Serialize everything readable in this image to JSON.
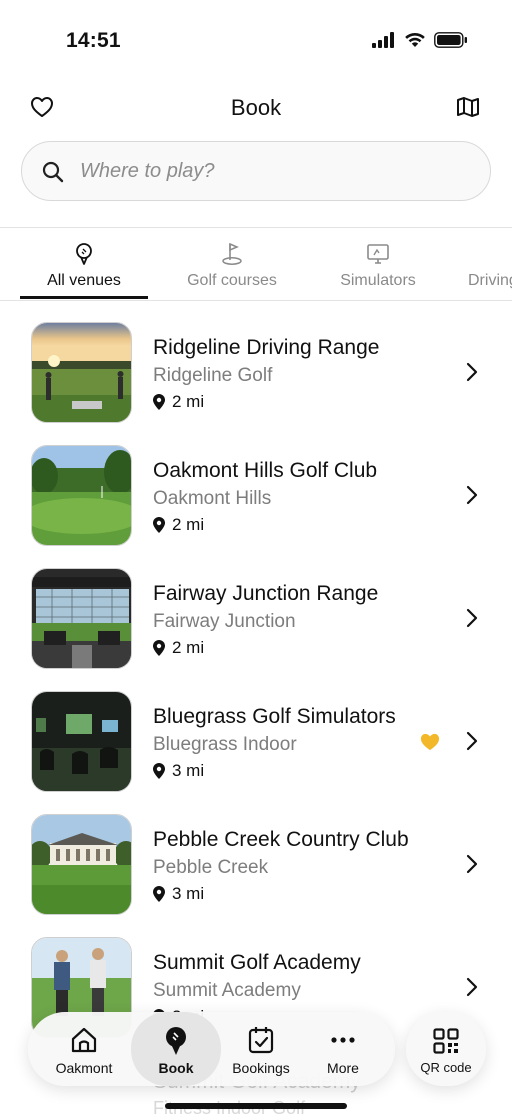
{
  "status": {
    "time": "14:51"
  },
  "header": {
    "title": "Book"
  },
  "search": {
    "placeholder": "Where to play?",
    "value": ""
  },
  "tabs": [
    {
      "label": "All venues",
      "icon": "golf-ball-tee-icon",
      "active": true
    },
    {
      "label": "Golf courses",
      "icon": "golf-flag-icon",
      "active": false
    },
    {
      "label": "Simulators",
      "icon": "simulator-screen-icon",
      "active": false
    },
    {
      "label": "Driving ranges",
      "icon": "driving-range-icon",
      "active": false
    }
  ],
  "venues": [
    {
      "name": "Ridgeline Driving Range",
      "subtitle": "Ridgeline Golf",
      "distance": "2 mi",
      "favorite": false
    },
    {
      "name": "Oakmont Hills Golf Club",
      "subtitle": "Oakmont Hills",
      "distance": "2 mi",
      "favorite": false
    },
    {
      "name": "Fairway Junction Range",
      "subtitle": "Fairway Junction",
      "distance": "2 mi",
      "favorite": false
    },
    {
      "name": "Bluegrass Golf Simulators",
      "subtitle": "Bluegrass Indoor",
      "distance": "3 mi",
      "favorite": true
    },
    {
      "name": "Pebble Creek Country Club",
      "subtitle": "Pebble Creek",
      "distance": "3 mi",
      "favorite": false
    },
    {
      "name": "Summit Golf Academy",
      "subtitle": "Summit Academy",
      "distance": "3 mi",
      "favorite": false
    }
  ],
  "behind_nav": {
    "name": "Summit Golf Academy",
    "subtitle": "Fitness Indoor Golf"
  },
  "bottom_nav": [
    {
      "label": "Oakmont",
      "icon": "home-icon",
      "active": false
    },
    {
      "label": "Book",
      "icon": "golf-ball-tee-icon",
      "active": true
    },
    {
      "label": "Bookings",
      "icon": "calendar-check-icon",
      "active": false
    },
    {
      "label": "More",
      "icon": "more-dots-icon",
      "active": false
    }
  ],
  "qr": {
    "label": "QR code",
    "icon": "qr-code-icon"
  },
  "colors": {
    "favorite": "#f2b829",
    "text": "#111111",
    "muted": "#7d7d7d"
  }
}
